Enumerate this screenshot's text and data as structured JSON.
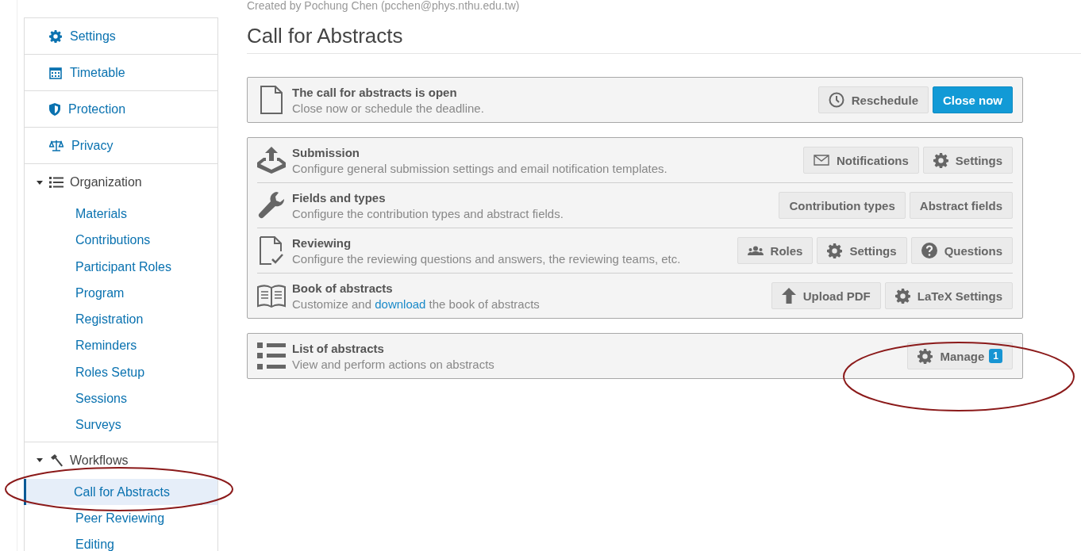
{
  "header": {
    "created_by": "Created by Pochung Chen (pcchen@phys.nthu.edu.tw)",
    "title": "Call for Abstracts"
  },
  "sidebar": {
    "items": [
      {
        "label": "Settings",
        "kind": "link"
      },
      {
        "label": "Timetable",
        "kind": "link"
      },
      {
        "label": "Protection",
        "kind": "link"
      },
      {
        "label": "Privacy",
        "kind": "link"
      },
      {
        "label": "Organization",
        "kind": "group",
        "expanded": true,
        "children": [
          {
            "label": "Materials",
            "selected": false
          },
          {
            "label": "Contributions",
            "selected": false
          },
          {
            "label": "Participant Roles",
            "selected": false
          },
          {
            "label": "Program",
            "selected": false
          },
          {
            "label": "Registration",
            "selected": false
          },
          {
            "label": "Reminders",
            "selected": false
          },
          {
            "label": "Roles Setup",
            "selected": false
          },
          {
            "label": "Sessions",
            "selected": false
          },
          {
            "label": "Surveys",
            "selected": false
          }
        ]
      },
      {
        "label": "Workflows",
        "kind": "group",
        "expanded": true,
        "children": [
          {
            "label": "Call for Abstracts",
            "selected": true
          },
          {
            "label": "Peer Reviewing",
            "selected": false
          },
          {
            "label": "Editing",
            "selected": false
          }
        ]
      }
    ]
  },
  "status_panel": {
    "title": "The call for abstracts is open",
    "description": [
      {
        "text": "Close now or schedule the deadline."
      }
    ],
    "buttons": [
      {
        "label": "Reschedule",
        "kind": "default"
      },
      {
        "label": "Close now",
        "kind": "primary"
      }
    ]
  },
  "sections": [
    {
      "title": "Submission",
      "description": [
        {
          "text": "Configure general submission settings and email notification templates."
        }
      ],
      "buttons": [
        {
          "label": "Notifications",
          "kind": "default"
        },
        {
          "label": "Settings",
          "kind": "default"
        }
      ]
    },
    {
      "title": "Fields and types",
      "description": [
        {
          "text": "Configure the contribution types and abstract fields."
        }
      ],
      "buttons": [
        {
          "label": "Contribution types",
          "kind": "default"
        },
        {
          "label": "Abstract fields",
          "kind": "default"
        }
      ]
    },
    {
      "title": "Reviewing",
      "description": [
        {
          "text": "Configure the reviewing questions and answers, the reviewing teams, etc."
        }
      ],
      "buttons": [
        {
          "label": "Roles",
          "kind": "default"
        },
        {
          "label": "Settings",
          "kind": "default"
        },
        {
          "label": "Questions",
          "kind": "default"
        }
      ]
    },
    {
      "title": "Book of abstracts",
      "description": [
        {
          "text": "Customize and "
        },
        {
          "text": "download",
          "kind": "link"
        },
        {
          "text": " the book of abstracts"
        }
      ],
      "buttons": [
        {
          "label": "Upload PDF",
          "kind": "default"
        },
        {
          "label": "LaTeX Settings",
          "kind": "default"
        }
      ]
    }
  ],
  "list_panel": {
    "title": "List of abstracts",
    "description": [
      {
        "text": "View and perform actions on abstracts"
      }
    ],
    "buttons": [
      {
        "label": "Manage",
        "kind": "default",
        "badge": "1"
      }
    ]
  }
}
